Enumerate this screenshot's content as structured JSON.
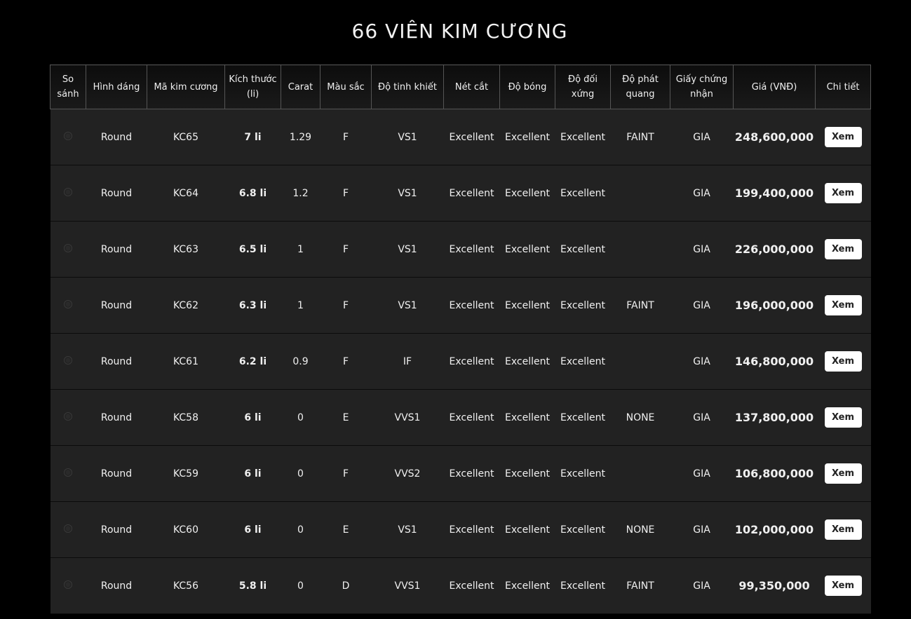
{
  "title": "66 VIÊN KIM CƯƠNG",
  "headers": [
    "So sánh",
    "Hình dáng",
    "Mã kim cương",
    "Kích thước (li)",
    "Carat",
    "Màu sắc",
    "Độ tinh khiết",
    "Nét cắt",
    "Độ bóng",
    "Độ đối xứng",
    "Độ phát quang",
    "Giấy chứng nhận",
    "Giá (VNĐ)",
    "Chi tiết"
  ],
  "view_label": "Xem",
  "rows": [
    {
      "shape": "Round",
      "code": "KC65",
      "size": "7 li",
      "carat": "1.29",
      "color": "F",
      "clarity": "VS1",
      "cut": "Excellent",
      "polish": "Excellent",
      "symmetry": "Excellent",
      "fluorescence": "FAINT",
      "cert": "GIA",
      "price": "248,600,000"
    },
    {
      "shape": "Round",
      "code": "KC64",
      "size": "6.8 li",
      "carat": "1.2",
      "color": "F",
      "clarity": "VS1",
      "cut": "Excellent",
      "polish": "Excellent",
      "symmetry": "Excellent",
      "fluorescence": "",
      "cert": "GIA",
      "price": "199,400,000"
    },
    {
      "shape": "Round",
      "code": "KC63",
      "size": "6.5 li",
      "carat": "1",
      "color": "F",
      "clarity": "VS1",
      "cut": "Excellent",
      "polish": "Excellent",
      "symmetry": "Excellent",
      "fluorescence": "",
      "cert": "GIA",
      "price": "226,000,000"
    },
    {
      "shape": "Round",
      "code": "KC62",
      "size": "6.3 li",
      "carat": "1",
      "color": "F",
      "clarity": "VS1",
      "cut": "Excellent",
      "polish": "Excellent",
      "symmetry": "Excellent",
      "fluorescence": "FAINT",
      "cert": "GIA",
      "price": "196,000,000"
    },
    {
      "shape": "Round",
      "code": "KC61",
      "size": "6.2 li",
      "carat": "0.9",
      "color": "F",
      "clarity": "IF",
      "cut": "Excellent",
      "polish": "Excellent",
      "symmetry": "Excellent",
      "fluorescence": "",
      "cert": "GIA",
      "price": "146,800,000"
    },
    {
      "shape": "Round",
      "code": "KC58",
      "size": "6 li",
      "carat": "0",
      "color": "E",
      "clarity": "VVS1",
      "cut": "Excellent",
      "polish": "Excellent",
      "symmetry": "Excellent",
      "fluorescence": "NONE",
      "cert": "GIA",
      "price": "137,800,000"
    },
    {
      "shape": "Round",
      "code": "KC59",
      "size": "6 li",
      "carat": "0",
      "color": "F",
      "clarity": "VVS2",
      "cut": "Excellent",
      "polish": "Excellent",
      "symmetry": "Excellent",
      "fluorescence": "",
      "cert": "GIA",
      "price": "106,800,000"
    },
    {
      "shape": "Round",
      "code": "KC60",
      "size": "6 li",
      "carat": "0",
      "color": "E",
      "clarity": "VS1",
      "cut": "Excellent",
      "polish": "Excellent",
      "symmetry": "Excellent",
      "fluorescence": "NONE",
      "cert": "GIA",
      "price": "102,000,000"
    },
    {
      "shape": "Round",
      "code": "KC56",
      "size": "5.8 li",
      "carat": "0",
      "color": "D",
      "clarity": "VVS1",
      "cut": "Excellent",
      "polish": "Excellent",
      "symmetry": "Excellent",
      "fluorescence": "FAINT",
      "cert": "GIA",
      "price": "99,350,000"
    }
  ],
  "colors": {
    "background": "#000000",
    "row_background": "#222222",
    "button_background": "#ffffff"
  }
}
